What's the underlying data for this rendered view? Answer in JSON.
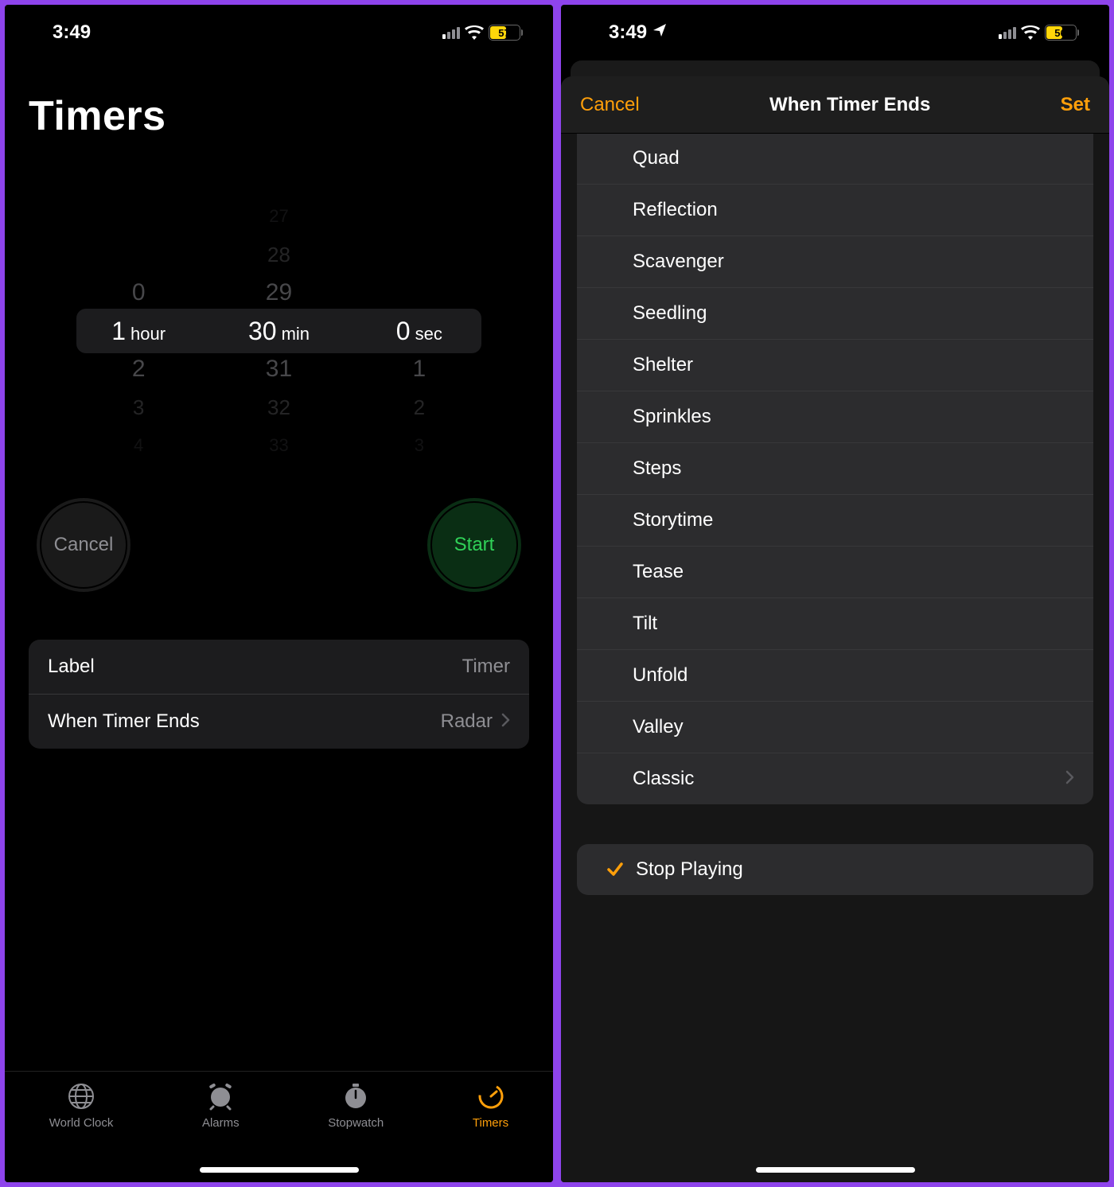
{
  "left": {
    "status": {
      "time": "3:49",
      "battery": "57",
      "battery_fill_pct": 57
    },
    "title": "Timers",
    "picker": {
      "hours": {
        "selected": "1",
        "unit": "hour",
        "above": [
          "0"
        ],
        "below": [
          "2",
          "3",
          "4"
        ]
      },
      "minutes": {
        "selected": "30",
        "unit": "min",
        "above": [
          "27",
          "28",
          "29"
        ],
        "below": [
          "31",
          "32",
          "33"
        ]
      },
      "seconds": {
        "selected": "0",
        "unit": "sec",
        "above": [],
        "below": [
          "1",
          "2",
          "3"
        ]
      }
    },
    "buttons": {
      "cancel": "Cancel",
      "start": "Start"
    },
    "rows": {
      "label_title": "Label",
      "label_value": "Timer",
      "ends_title": "When Timer Ends",
      "ends_value": "Radar"
    },
    "tabs": {
      "world_clock": "World Clock",
      "alarms": "Alarms",
      "stopwatch": "Stopwatch",
      "timers": "Timers"
    }
  },
  "right": {
    "status": {
      "time": "3:49",
      "battery": "56",
      "battery_fill_pct": 56,
      "has_location": true
    },
    "sheet": {
      "cancel": "Cancel",
      "title": "When Timer Ends",
      "set": "Set",
      "sounds": [
        "Quad",
        "Reflection",
        "Scavenger",
        "Seedling",
        "Shelter",
        "Sprinkles",
        "Steps",
        "Storytime",
        "Tease",
        "Tilt",
        "Unfold",
        "Valley",
        "Classic"
      ],
      "classic_has_chevron": true,
      "stop_playing": "Stop Playing",
      "stop_playing_checked": true
    }
  }
}
